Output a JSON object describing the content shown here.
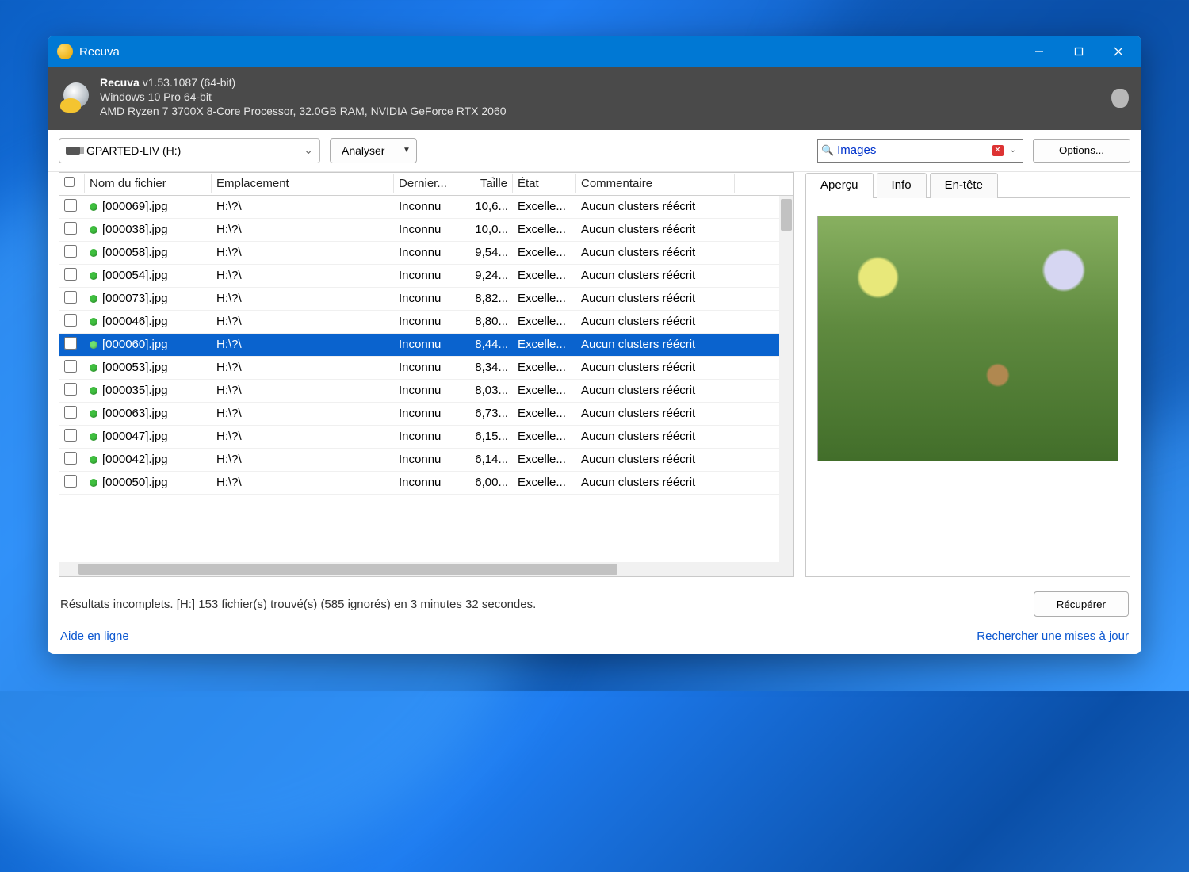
{
  "titlebar": {
    "title": "Recuva"
  },
  "header": {
    "app_name": "Recuva",
    "version": "v1.53.1087 (64-bit)",
    "os": "Windows 10 Pro 64-bit",
    "hardware": "AMD Ryzen 7 3700X 8-Core Processor, 32.0GB RAM, NVIDIA GeForce RTX 2060"
  },
  "toolbar": {
    "drive": "GPARTED-LIV (H:)",
    "analyze": "Analyser",
    "filter": "Images",
    "options": "Options..."
  },
  "columns": {
    "filename": "Nom du fichier",
    "location": "Emplacement",
    "modified": "Dernier...",
    "size": "Taille",
    "state": "État",
    "comment": "Commentaire"
  },
  "rows": [
    {
      "name": "[000069].jpg",
      "loc": "H:\\?\\",
      "mod": "Inconnu",
      "size": "10,6...",
      "state": "Excelle...",
      "comment": "Aucun clusters réécrit",
      "selected": false
    },
    {
      "name": "[000038].jpg",
      "loc": "H:\\?\\",
      "mod": "Inconnu",
      "size": "10,0...",
      "state": "Excelle...",
      "comment": "Aucun clusters réécrit",
      "selected": false
    },
    {
      "name": "[000058].jpg",
      "loc": "H:\\?\\",
      "mod": "Inconnu",
      "size": "9,54...",
      "state": "Excelle...",
      "comment": "Aucun clusters réécrit",
      "selected": false
    },
    {
      "name": "[000054].jpg",
      "loc": "H:\\?\\",
      "mod": "Inconnu",
      "size": "9,24...",
      "state": "Excelle...",
      "comment": "Aucun clusters réécrit",
      "selected": false
    },
    {
      "name": "[000073].jpg",
      "loc": "H:\\?\\",
      "mod": "Inconnu",
      "size": "8,82...",
      "state": "Excelle...",
      "comment": "Aucun clusters réécrit",
      "selected": false
    },
    {
      "name": "[000046].jpg",
      "loc": "H:\\?\\",
      "mod": "Inconnu",
      "size": "8,80...",
      "state": "Excelle...",
      "comment": "Aucun clusters réécrit",
      "selected": false
    },
    {
      "name": "[000060].jpg",
      "loc": "H:\\?\\",
      "mod": "Inconnu",
      "size": "8,44...",
      "state": "Excelle...",
      "comment": "Aucun clusters réécrit",
      "selected": true
    },
    {
      "name": "[000053].jpg",
      "loc": "H:\\?\\",
      "mod": "Inconnu",
      "size": "8,34...",
      "state": "Excelle...",
      "comment": "Aucun clusters réécrit",
      "selected": false
    },
    {
      "name": "[000035].jpg",
      "loc": "H:\\?\\",
      "mod": "Inconnu",
      "size": "8,03...",
      "state": "Excelle...",
      "comment": "Aucun clusters réécrit",
      "selected": false
    },
    {
      "name": "[000063].jpg",
      "loc": "H:\\?\\",
      "mod": "Inconnu",
      "size": "6,73...",
      "state": "Excelle...",
      "comment": "Aucun clusters réécrit",
      "selected": false
    },
    {
      "name": "[000047].jpg",
      "loc": "H:\\?\\",
      "mod": "Inconnu",
      "size": "6,15...",
      "state": "Excelle...",
      "comment": "Aucun clusters réécrit",
      "selected": false
    },
    {
      "name": "[000042].jpg",
      "loc": "H:\\?\\",
      "mod": "Inconnu",
      "size": "6,14...",
      "state": "Excelle...",
      "comment": "Aucun clusters réécrit",
      "selected": false
    },
    {
      "name": "[000050].jpg",
      "loc": "H:\\?\\",
      "mod": "Inconnu",
      "size": "6,00...",
      "state": "Excelle...",
      "comment": "Aucun clusters réécrit",
      "selected": false
    }
  ],
  "tabs": {
    "preview": "Aperçu",
    "info": "Info",
    "header": "En-tête"
  },
  "status": "Résultats incomplets. [H:] 153 fichier(s) trouvé(s) (585 ignorés) en 3 minutes 32 secondes.",
  "recover": "Récupérer",
  "links": {
    "help": "Aide en ligne",
    "update": "Rechercher une mises à jour"
  }
}
